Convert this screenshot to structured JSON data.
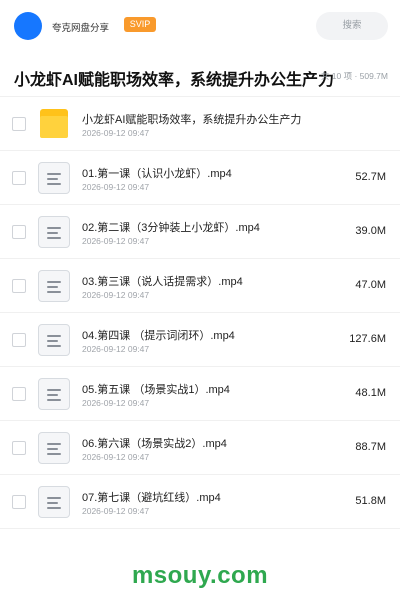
{
  "header": {
    "user_name": "夸克网盘分享",
    "badge": "SVIP",
    "search_placeholder": "搜索",
    "avatar_color": "#1677ff",
    "badge_color": "#f99a2c"
  },
  "title_row": {
    "title": "小龙虾AI赋能职场效率，系统提升办公生产力",
    "summary": "共 10 项 · 509.7M"
  },
  "files": [
    {
      "icon": "folder-icon",
      "name": "小龙虾AI赋能职场效率，系统提升办公生产力",
      "date": "2026-09-12 09:47",
      "size": ""
    },
    {
      "icon": "document-icon",
      "name": "01.第一课（认识小龙虾）.mp4",
      "date": "2026-09-12 09:47",
      "size": "52.7M"
    },
    {
      "icon": "document-icon",
      "name": "02.第二课（3分钟装上小龙虾）.mp4",
      "date": "2026-09-12 09:47",
      "size": "39.0M"
    },
    {
      "icon": "document-icon",
      "name": "03.第三课（说人话提需求）.mp4",
      "date": "2026-09-12 09:47",
      "size": "47.0M"
    },
    {
      "icon": "document-icon",
      "name": "04.第四课 （提示词闭环）.mp4",
      "date": "2026-09-12 09:47",
      "size": "127.6M"
    },
    {
      "icon": "document-icon",
      "name": "05.第五课 （场景实战1）.mp4",
      "date": "2026-09-12 09:47",
      "size": "48.1M"
    },
    {
      "icon": "document-icon",
      "name": "06.第六课（场景实战2）.mp4",
      "date": "2026-09-12 09:47",
      "size": "88.7M"
    },
    {
      "icon": "document-icon",
      "name": "07.第七课（避坑红线）.mp4",
      "date": "2026-09-12 09:47",
      "size": "51.8M"
    }
  ],
  "watermark": "msouy.com",
  "watermark_color": "#2fa84f"
}
